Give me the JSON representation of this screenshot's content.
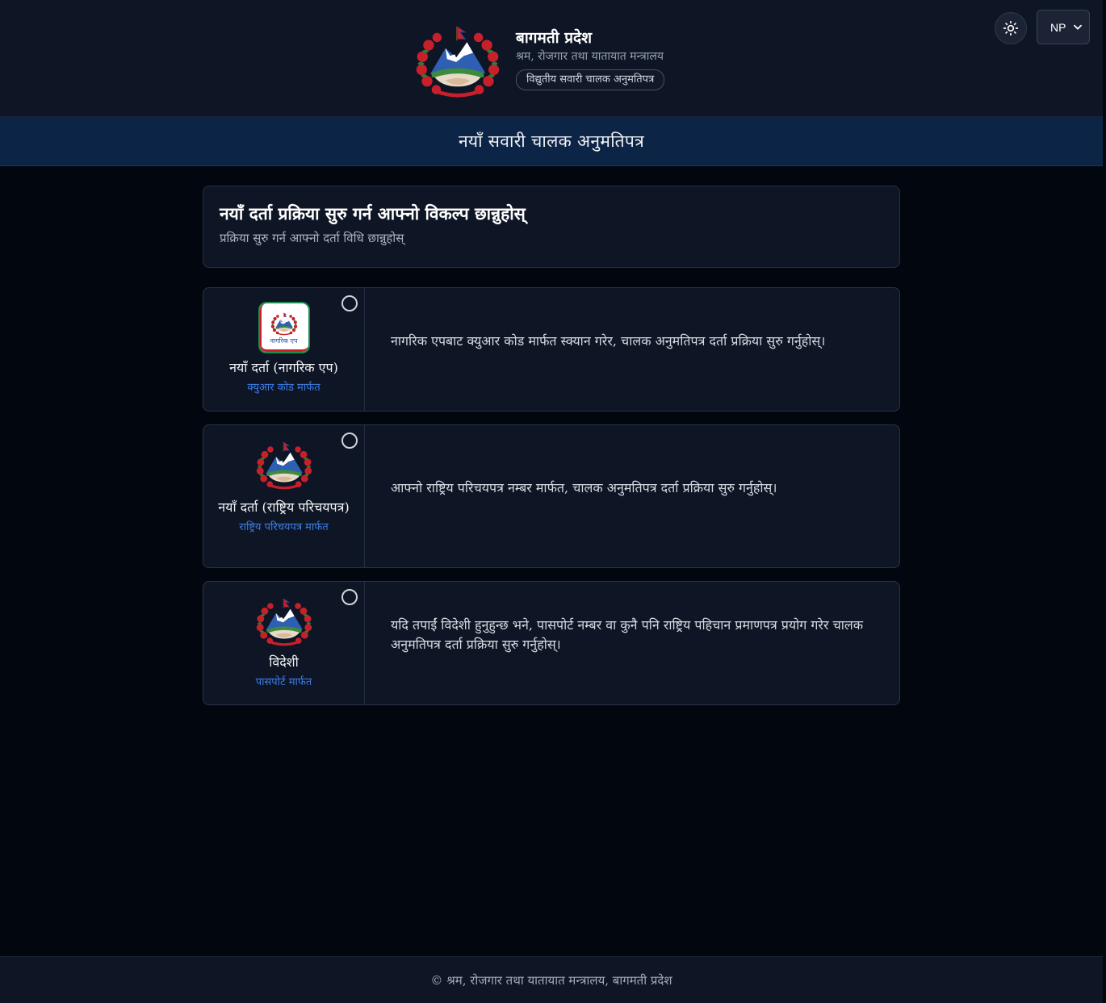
{
  "header": {
    "title": "बागमती प्रदेश",
    "ministry": "श्रम, रोजगार तथा यातायात मन्त्रालय",
    "badge": "विद्युतीय सवारी चालक अनुमतिपत्र",
    "theme_icon": "sun-icon",
    "language": {
      "selected": "NP",
      "icon": "chevron-down-icon"
    }
  },
  "band": {
    "title": "नयाँ सवारी चालक अनुमतिपत्र"
  },
  "intro": {
    "title": "नयाँ दर्ता प्रक्रिया सुरु गर्न आफ्नो विकल्प छान्नुहोस्",
    "subtitle": "प्रक्रिया सुरु गर्न आफ्नो दर्ता विधि छान्नुहोस्"
  },
  "options": [
    {
      "title": "नयाँ दर्ता (नागरिक एप)",
      "tag": "क्युआर कोड मार्फत",
      "logo_label": "नागरिक एप",
      "description": "नागरिक एपबाट क्युआर कोड मार्फत स्क्यान गरेर, चालक अनुमतिपत्र दर्ता प्रक्रिया सुरु गर्नुहोस्।",
      "selected": false
    },
    {
      "title": "नयाँ दर्ता (राष्ट्रिय परिचयपत्र)",
      "tag": "राष्ट्रिय परिचयपत्र मार्फत",
      "description": "आफ्नो राष्ट्रिय परिचयपत्र नम्बर मार्फत, चालक अनुमतिपत्र दर्ता प्रक्रिया सुरु गर्नुहोस्।",
      "selected": false
    },
    {
      "title": "विदेशी",
      "tag": "पासपोर्ट मार्फत",
      "description": "यदि तपाईं विदेशी हुनुहुन्छ भने, पासपोर्ट नम्बर वा कुनै पनि राष्ट्रिय पहिचान प्रमाणपत्र प्रयोग गरेर चालक अनुमतिपत्र दर्ता प्रक्रिया सुरु गर्नुहोस्।",
      "selected": false
    }
  ],
  "footer": {
    "text": "© श्रम, रोजगार तथा यातायात मन्त्रालय, बागमती प्रदेश"
  },
  "colors": {
    "page_bg": "#02060f",
    "panel_bg": "#0e1525",
    "band_bg": "#0c2547",
    "link_blue": "#3b7ee6"
  }
}
